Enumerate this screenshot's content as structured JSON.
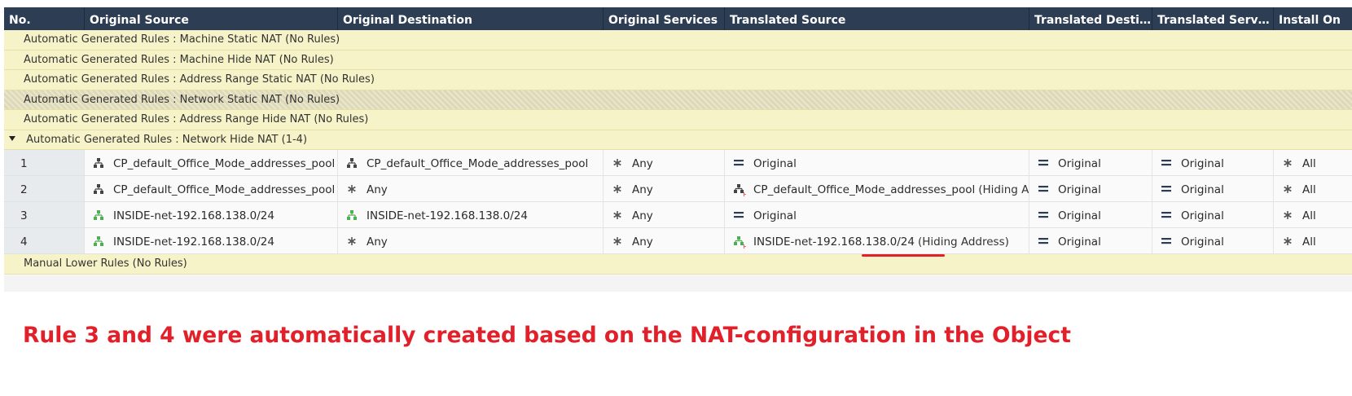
{
  "columns": [
    "No.",
    "Original Source",
    "Original Destination",
    "Original Services",
    "Translated Source",
    "Translated Destin...",
    "Translated Services",
    "Install On"
  ],
  "sections_top": [
    {
      "label": "Automatic Generated Rules : Machine Static NAT",
      "count": "(No Rules)"
    },
    {
      "label": "Automatic Generated Rules : Machine Hide NAT",
      "count": "(No Rules)"
    },
    {
      "label": "Automatic Generated Rules : Address Range Static NAT",
      "count": "(No Rules)"
    },
    {
      "label": "Automatic Generated Rules : Network Static NAT",
      "count": "(No Rules)"
    },
    {
      "label": "Automatic Generated Rules : Address Range Hide NAT",
      "count": "(No Rules)"
    }
  ],
  "open_section": {
    "label": "Automatic Generated Rules : Network Hide NAT",
    "count": "(1-4)"
  },
  "rules": [
    {
      "no": "1",
      "src": "CP_default_Office_Mode_addresses_pool",
      "dst": "CP_default_Office_Mode_addresses_pool",
      "svc": "Any",
      "tsrc": "Original",
      "tsrc_suffix": "",
      "tdst": "Original",
      "tsvc": "Original",
      "install": "All"
    },
    {
      "no": "2",
      "src": "CP_default_Office_Mode_addresses_pool",
      "dst": "Any",
      "svc": "Any",
      "tsrc": "CP_default_Office_Mode_addresses_pool",
      "tsrc_suffix": "(Hiding Addr",
      "tdst": "Original",
      "tsvc": "Original",
      "install": "All"
    },
    {
      "no": "3",
      "src": "INSIDE-net-192.168.138.0/24",
      "dst": "INSIDE-net-192.168.138.0/24",
      "svc": "Any",
      "tsrc": "Original",
      "tsrc_suffix": "",
      "tdst": "Original",
      "tsvc": "Original",
      "install": "All"
    },
    {
      "no": "4",
      "src": "INSIDE-net-192.168.138.0/24",
      "dst": "Any",
      "svc": "Any",
      "tsrc": "INSIDE-net-192.168.138.0/24",
      "tsrc_suffix": "(Hiding Address)",
      "tdst": "Original",
      "tsvc": "Original",
      "install": "All"
    }
  ],
  "section_bottom": {
    "label": "Manual Lower Rules",
    "count": "(No Rules)"
  },
  "annotation": "Rule 3 and 4 were automatically created based on the NAT-configuration in the Object",
  "colors": {
    "header_bg": "#2d3e54",
    "section_bg": "#f7f3c8",
    "annotation": "#e2202a",
    "network_green": "#4caf50"
  }
}
